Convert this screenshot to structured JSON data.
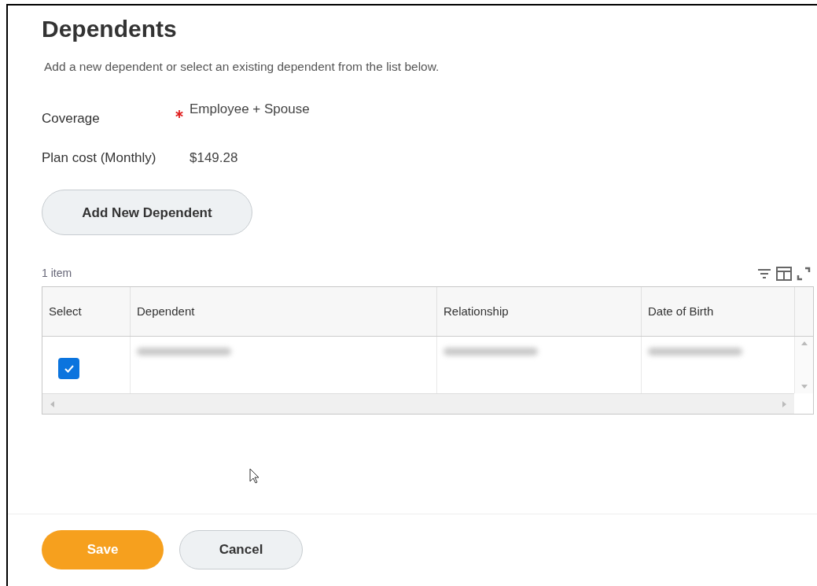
{
  "title": "Dependents",
  "instructions": "Add a new dependent or select an existing dependent from the list below.",
  "fields": [
    {
      "label": "Coverage",
      "required": true,
      "value": "Employee + Spouse"
    },
    {
      "label": "Plan cost (Monthly)",
      "required": false,
      "value": "$149.28"
    }
  ],
  "add_button": "Add New Dependent",
  "table": {
    "count": "1 item",
    "columns": [
      "Select",
      "Dependent",
      "Relationship",
      "Date of Birth"
    ],
    "rows": [
      {
        "selected": true,
        "cells": [
          {
            "kind": "redacted"
          },
          {
            "kind": "redacted"
          },
          {
            "kind": "redacted"
          }
        ]
      }
    ]
  },
  "buttons": [
    {
      "label": "Save",
      "kind": "primary"
    },
    {
      "label": "Cancel",
      "kind": "secondary"
    }
  ]
}
